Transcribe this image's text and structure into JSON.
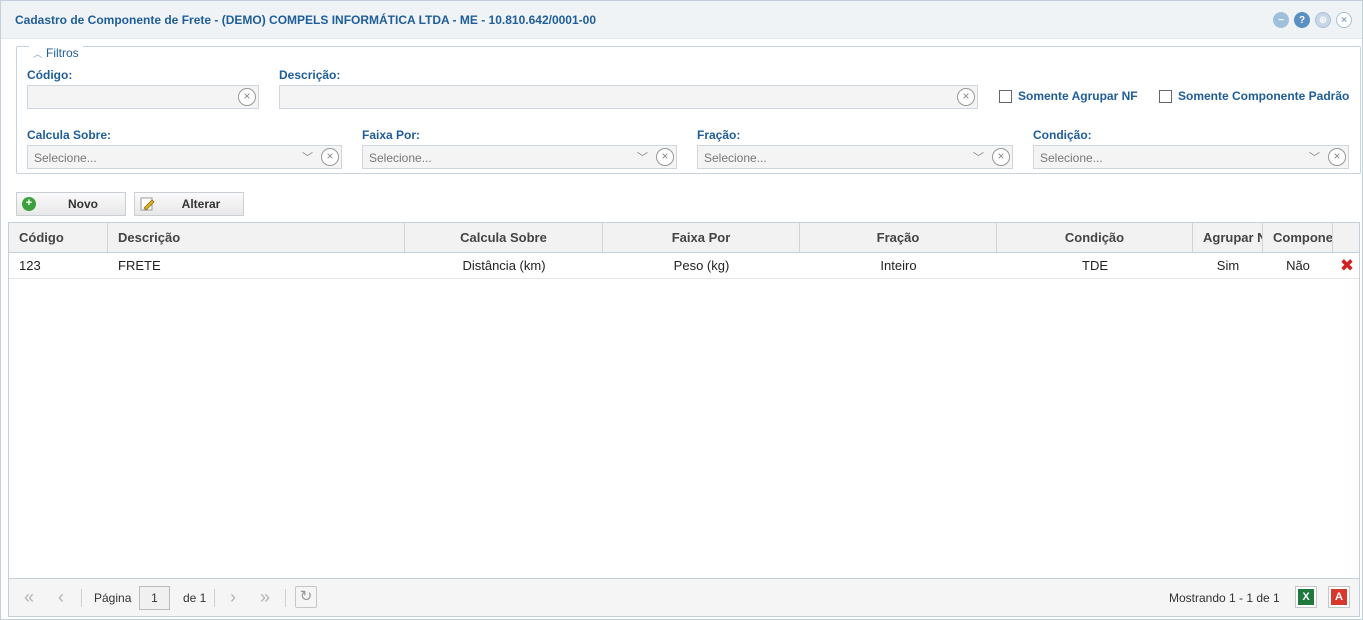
{
  "window": {
    "title": "Cadastro de Componente de Frete - (DEMO) COMPELS INFORMÁTICA LTDA - ME - 10.810.642/0001-00",
    "help_glyph": "?"
  },
  "filters": {
    "legend": "Filtros",
    "codigo_label": "Código:",
    "codigo_value": "",
    "descricao_label": "Descrição:",
    "descricao_value": "",
    "somente_agrupar_nf": "Somente Agrupar NF",
    "somente_componente_padrao": "Somente Componente Padrão",
    "calcula_sobre_label": "Calcula Sobre:",
    "faixa_por_label": "Faixa Por:",
    "fracao_label": "Fração:",
    "condicao_label": "Condição:",
    "select_placeholder": "Selecione..."
  },
  "toolbar": {
    "novo": "Novo",
    "alterar": "Alterar"
  },
  "grid": {
    "columns": [
      "Código",
      "Descrição",
      "Calcula Sobre",
      "Faixa Por",
      "Fração",
      "Condição",
      "Agrupar N",
      "Compone"
    ],
    "rows": [
      [
        "123",
        "FRETE",
        "Distância (km)",
        "Peso (kg)",
        "Inteiro",
        "TDE",
        "Sim",
        "Não"
      ]
    ]
  },
  "pager": {
    "page_label": "Página",
    "page_value": "1",
    "of_label": "de 1",
    "showing": "Mostrando 1 - 1 de 1"
  },
  "icons": {
    "xls": "X",
    "pdf": "A"
  }
}
